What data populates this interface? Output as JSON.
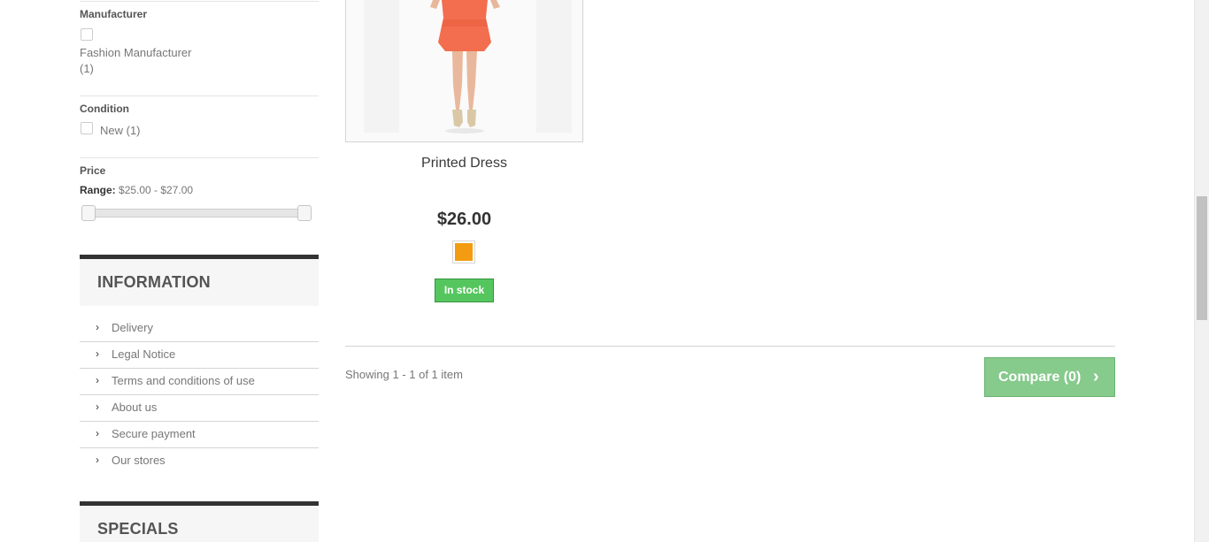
{
  "filters": {
    "manufacturer": {
      "title": "Manufacturer",
      "option_label": "Fashion Manufacturer",
      "option_count": "(1)"
    },
    "condition": {
      "title": "Condition",
      "option_label": "New (1)"
    },
    "price": {
      "title": "Price",
      "range_label": "Range:",
      "range_value": "$25.00 - $27.00",
      "min": 25.0,
      "max": 27.0
    }
  },
  "information": {
    "title": "INFORMATION",
    "items": [
      {
        "label": "Delivery"
      },
      {
        "label": "Legal Notice"
      },
      {
        "label": "Terms and conditions of use"
      },
      {
        "label": "About us"
      },
      {
        "label": "Secure payment"
      },
      {
        "label": "Our stores"
      }
    ]
  },
  "specials": {
    "title": "SPECIALS"
  },
  "product": {
    "name": "Printed Dress",
    "price": "$26.00",
    "color_swatch": "#f39c11",
    "stock_label": "In stock"
  },
  "listing": {
    "showing_text": "Showing 1 - 1 of 1 item",
    "compare_label": "Compare (0)"
  },
  "icons": {
    "info_chevron": "chevron-right-icon",
    "compare_chevron": "chevron-right-icon"
  },
  "colors": {
    "in_stock": "#55c65e",
    "compare_button": "#86ca8c",
    "block_border": "#333333"
  }
}
